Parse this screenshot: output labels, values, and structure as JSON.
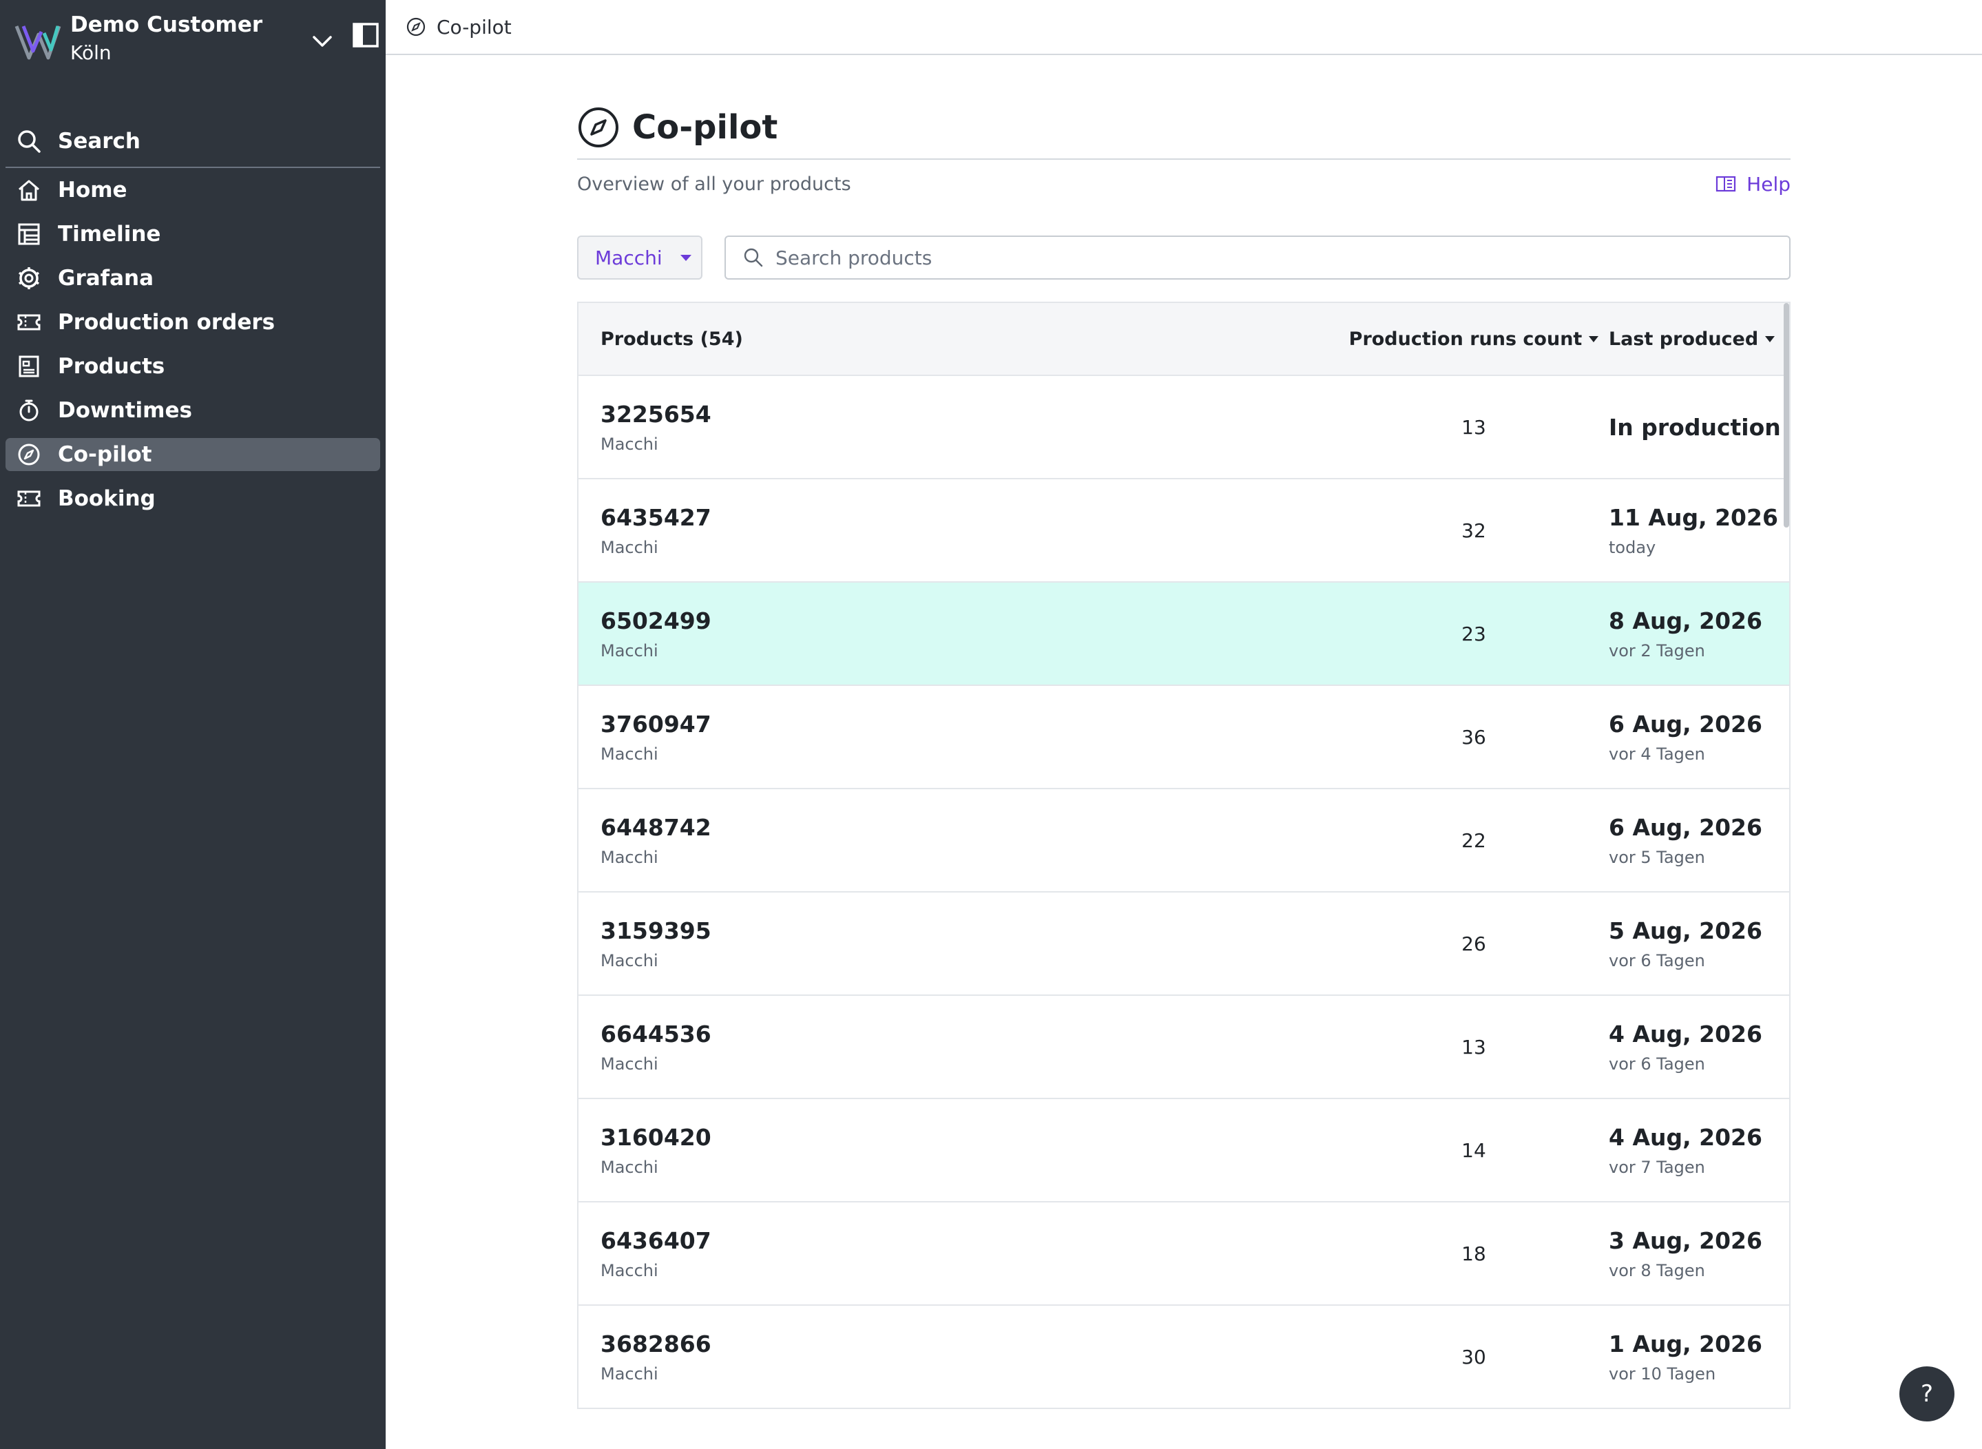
{
  "sidebar": {
    "org_name": "Demo Customer",
    "org_city": "Köln",
    "search_label": "Search",
    "items": [
      {
        "label": "Home",
        "icon": "home-icon"
      },
      {
        "label": "Timeline",
        "icon": "timeline-icon"
      },
      {
        "label": "Grafana",
        "icon": "grafana-icon"
      },
      {
        "label": "Production orders",
        "icon": "ticket-icon"
      },
      {
        "label": "Products",
        "icon": "products-icon"
      },
      {
        "label": "Downtimes",
        "icon": "stopwatch-icon"
      },
      {
        "label": "Co-pilot",
        "icon": "compass-icon",
        "active": true
      },
      {
        "label": "Booking",
        "icon": "ticket-icon"
      }
    ]
  },
  "topbar": {
    "title": "Co-pilot"
  },
  "page": {
    "title": "Co-pilot",
    "subtitle": "Overview of all your products",
    "help_label": "Help"
  },
  "filter": {
    "selected": "Macchi",
    "search_placeholder": "Search products"
  },
  "table": {
    "headers": {
      "products": "Products (54)",
      "runs": "Production runs count",
      "last": "Last produced"
    },
    "rows": [
      {
        "id": "3225654",
        "machine": "Macchi",
        "runs": "13",
        "last": "In production",
        "ago": ""
      },
      {
        "id": "6435427",
        "machine": "Macchi",
        "runs": "32",
        "last": "11 Aug, 2026",
        "ago": "today"
      },
      {
        "id": "6502499",
        "machine": "Macchi",
        "runs": "23",
        "last": "8 Aug, 2026",
        "ago": "vor 2 Tagen",
        "highlight": true
      },
      {
        "id": "3760947",
        "machine": "Macchi",
        "runs": "36",
        "last": "6 Aug, 2026",
        "ago": "vor 4 Tagen"
      },
      {
        "id": "6448742",
        "machine": "Macchi",
        "runs": "22",
        "last": "6 Aug, 2026",
        "ago": "vor 5 Tagen"
      },
      {
        "id": "3159395",
        "machine": "Macchi",
        "runs": "26",
        "last": "5 Aug, 2026",
        "ago": "vor 6 Tagen"
      },
      {
        "id": "6644536",
        "machine": "Macchi",
        "runs": "13",
        "last": "4 Aug, 2026",
        "ago": "vor 6 Tagen"
      },
      {
        "id": "3160420",
        "machine": "Macchi",
        "runs": "14",
        "last": "4 Aug, 2026",
        "ago": "vor 7 Tagen"
      },
      {
        "id": "6436407",
        "machine": "Macchi",
        "runs": "18",
        "last": "3 Aug, 2026",
        "ago": "vor 8 Tagen"
      },
      {
        "id": "3682866",
        "machine": "Macchi",
        "runs": "30",
        "last": "1 Aug, 2026",
        "ago": "vor 10 Tagen"
      }
    ]
  },
  "help_fab": {
    "label": "?"
  },
  "colors": {
    "sidebar_bg": "#2f353d",
    "accent": "#6c3bd9",
    "highlight_row": "#d7fbf4"
  }
}
